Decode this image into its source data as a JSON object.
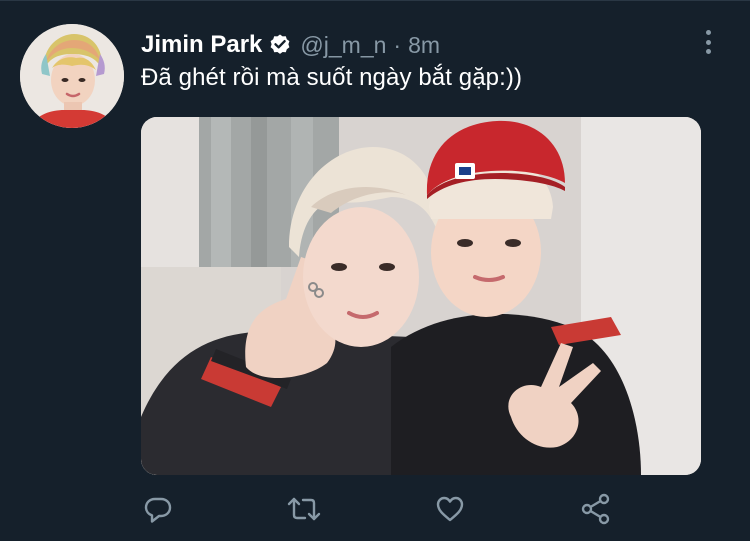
{
  "tweet": {
    "display_name": "Jimin Park",
    "handle": "@j_m_n",
    "separator": "·",
    "time": "8m",
    "text": "Đã ghét rồi mà suốt ngày bắt gặp:))",
    "verified": true
  },
  "icons": {
    "verified": "verified-badge-icon",
    "more": "more-vertical-icon",
    "reply": "reply-icon",
    "retweet": "retweet-icon",
    "like": "heart-icon",
    "share": "share-icon"
  },
  "colors": {
    "background": "#15202b",
    "secondary_text": "#8899a6",
    "divider": "#2a3744",
    "text": "#ffffff"
  }
}
